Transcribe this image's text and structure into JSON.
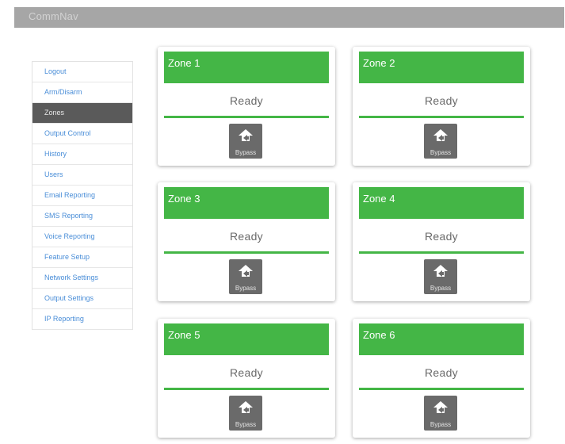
{
  "app": {
    "title": "CommNav"
  },
  "sidebar": {
    "items": [
      {
        "label": "Logout"
      },
      {
        "label": "Arm/Disarm"
      },
      {
        "label": "Zones",
        "active": true
      },
      {
        "label": "Output Control"
      },
      {
        "label": "History"
      },
      {
        "label": "Users"
      },
      {
        "label": "Email Reporting"
      },
      {
        "label": "SMS Reporting"
      },
      {
        "label": "Voice Reporting"
      },
      {
        "label": "Feature Setup"
      },
      {
        "label": "Network Settings"
      },
      {
        "label": "Output Settings"
      },
      {
        "label": "IP Reporting"
      }
    ]
  },
  "zones": [
    {
      "name": "Zone 1",
      "status": "Ready",
      "button": "Bypass"
    },
    {
      "name": "Zone 2",
      "status": "Ready",
      "button": "Bypass"
    },
    {
      "name": "Zone 3",
      "status": "Ready",
      "button": "Bypass"
    },
    {
      "name": "Zone 4",
      "status": "Ready",
      "button": "Bypass"
    },
    {
      "name": "Zone 5",
      "status": "Ready",
      "button": "Bypass"
    },
    {
      "name": "Zone 6",
      "status": "Ready",
      "button": "Bypass"
    }
  ],
  "colors": {
    "header_bar": "#a6a6a6",
    "zone_ready": "#44b646",
    "sidebar_active": "#5a5a5a",
    "link": "#4a8ed8"
  },
  "icons": {
    "bypass": "house-arrow-icon"
  }
}
